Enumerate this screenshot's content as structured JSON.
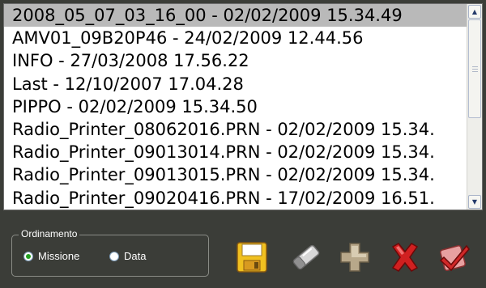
{
  "list": {
    "items": [
      "2008_05_07_03_16_00 - 02/02/2009 15.34.49",
      "AMV01_09B20P46 - 24/02/2009 12.44.56",
      "INFO - 27/03/2008 17.56.22",
      "Last - 12/10/2007 17.04.28",
      "PIPPO - 02/02/2009 15.34.50",
      "Radio_Printer_08062016.PRN - 02/02/2009 15.34.",
      "Radio_Printer_09013014.PRN - 02/02/2009 15.34.",
      "Radio_Printer_09013015.PRN - 02/02/2009 15.34.",
      "Radio_Printer_09020416.PRN - 17/02/2009 16.51."
    ],
    "selected_index": 0
  },
  "sort": {
    "legend": "Ordinamento",
    "option_mission": "Missione",
    "option_date": "Data",
    "selected": "Missione"
  },
  "toolbar": {
    "icons": [
      "save-icon",
      "edit-icon",
      "add-icon",
      "delete-icon",
      "confirm-icon"
    ]
  },
  "colors": {
    "background": "#3b3d38",
    "selection": "#b9b9b9",
    "radio_selected": "#21a121"
  }
}
